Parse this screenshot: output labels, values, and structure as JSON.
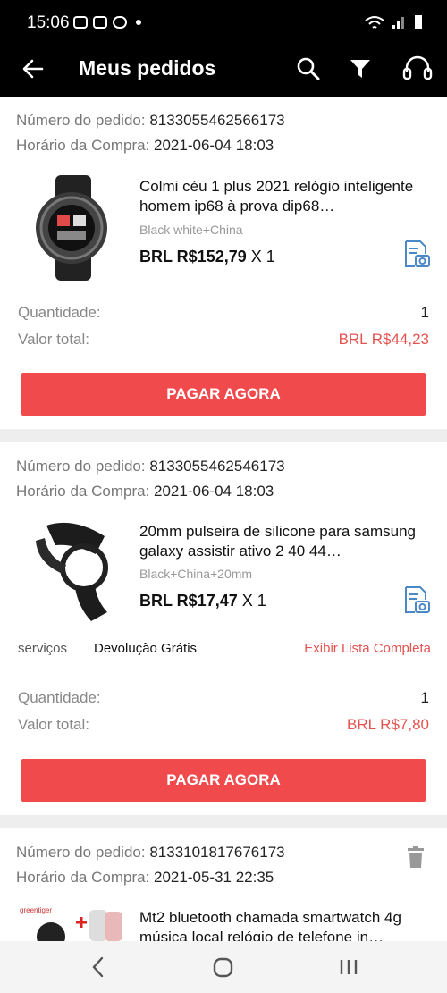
{
  "status": {
    "time": "15:06"
  },
  "appbar": {
    "title": "Meus pedidos"
  },
  "orders": [
    {
      "order_label": "Número do pedido:",
      "order_number": "8133055462566173",
      "time_label": "Horário da Compra:",
      "time": "2021-06-04 18:03",
      "product_title": "Colmi céu 1 plus 2021 relógio inteligente homem ip68 à prova dip68…",
      "variant": "Black white+China",
      "price": "BRL R$152,79",
      "qty": "X 1",
      "qty_label": "Quantidade:",
      "qty_value": "1",
      "total_label": "Valor total:",
      "total_value": "BRL R$44,23",
      "button": "PAGAR AGORA"
    },
    {
      "order_label": "Número do pedido:",
      "order_number": "8133055462546173",
      "time_label": "Horário da Compra:",
      "time": "2021-06-04 18:03",
      "product_title": "20mm pulseira de silicone para samsung galaxy assistir ativo 2 40 44…",
      "variant": "Black+China+20mm",
      "price": "BRL R$17,47",
      "qty": "X 1",
      "services_label": "serviços",
      "services_value": "Devolução Grátis",
      "services_link": "Exibir Lista Completa",
      "qty_label": "Quantidade:",
      "qty_value": "1",
      "total_label": "Valor total:",
      "total_value": "BRL R$7,80",
      "button": "PAGAR AGORA"
    },
    {
      "order_label": "Número do pedido:",
      "order_number": "8133101817676173",
      "time_label": "Horário da Compra:",
      "time": "2021-05-31 22:35",
      "product_title": "Mt2 bluetooth chamada smartwatch 4g música local relógio de telefone in…",
      "image_brand": "greentiger"
    }
  ],
  "colors": {
    "accent": "#f04a4d",
    "link_blue": "#4a88c8"
  }
}
